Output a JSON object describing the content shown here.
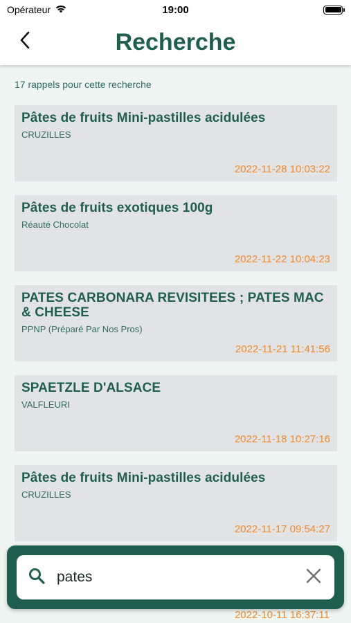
{
  "status": {
    "carrier": "Opérateur",
    "time": "19:00"
  },
  "header": {
    "title": "Recherche"
  },
  "results": {
    "count_text": "17 rappels pour cette recherche"
  },
  "items": [
    {
      "title": "Pâtes de fruits Mini-pastilles acidulées",
      "brand": "CRUZILLES",
      "date": "2022-11-28 10:03:22"
    },
    {
      "title": "Pâtes de fruits exotiques 100g",
      "brand": "Réauté Chocolat",
      "date": "2022-11-22 10:04:23"
    },
    {
      "title": "PATES CARBONARA REVISITEES ; PATES MAC & CHEESE",
      "brand": "PPNP (Préparé Par Nos Pros)",
      "date": "2022-11-21 11:41:56"
    },
    {
      "title": "SPAETZLE D'ALSACE",
      "brand": "VALFLEURI",
      "date": "2022-11-18 10:27:16"
    },
    {
      "title": "Pâtes de fruits Mini-pastilles acidulées",
      "brand": "CRUZILLES",
      "date": "2022-11-17 09:54:27"
    }
  ],
  "partial_item": {
    "date": "2022-10-11 16:37:11"
  },
  "search": {
    "value": "pates"
  },
  "colors": {
    "primary": "#1f5e4f",
    "accent": "#f0892a",
    "card": "#e2e3e5",
    "background": "#eef5f2"
  }
}
